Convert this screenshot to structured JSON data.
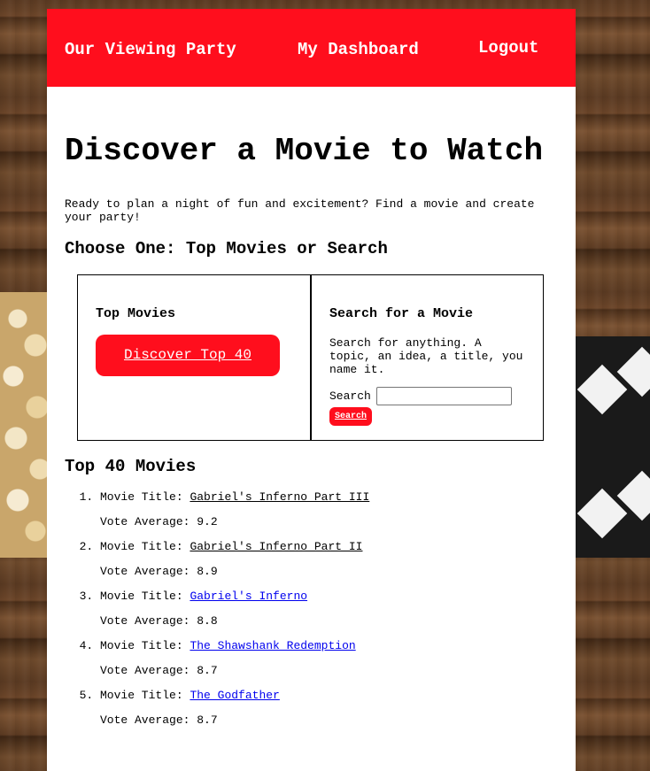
{
  "nav": {
    "brand": "Our Viewing Party",
    "dashboard": "My Dashboard",
    "logout": "Logout"
  },
  "main": {
    "title": "Discover a Movie to Watch",
    "intro": "Ready to plan a night of fun and excitement? Find a movie and create your party!",
    "choose_heading": "Choose One: Top Movies or Search"
  },
  "top_panel": {
    "heading": "Top Movies",
    "button_label": "Discover Top 40"
  },
  "search_panel": {
    "heading": "Search for a Movie",
    "description": "Search for anything. A topic, an idea, a title, you name it.",
    "field_label": "Search",
    "input_value": "",
    "button_label": "Search"
  },
  "results": {
    "heading": "Top 40 Movies",
    "title_prefix": "Movie Title:",
    "vote_prefix": "Vote Average:",
    "items": [
      {
        "title": "Gabriel's Inferno Part III",
        "vote": "9.2",
        "visited": true
      },
      {
        "title": "Gabriel's Inferno Part II",
        "vote": "8.9",
        "visited": true
      },
      {
        "title": "Gabriel's Inferno",
        "vote": "8.8",
        "visited": false
      },
      {
        "title": "The Shawshank Redemption",
        "vote": "8.7",
        "visited": false
      },
      {
        "title": "The Godfather",
        "vote": "8.7",
        "visited": false
      }
    ]
  },
  "colors": {
    "accent": "#ff0e1d",
    "link": "#0000ee"
  }
}
